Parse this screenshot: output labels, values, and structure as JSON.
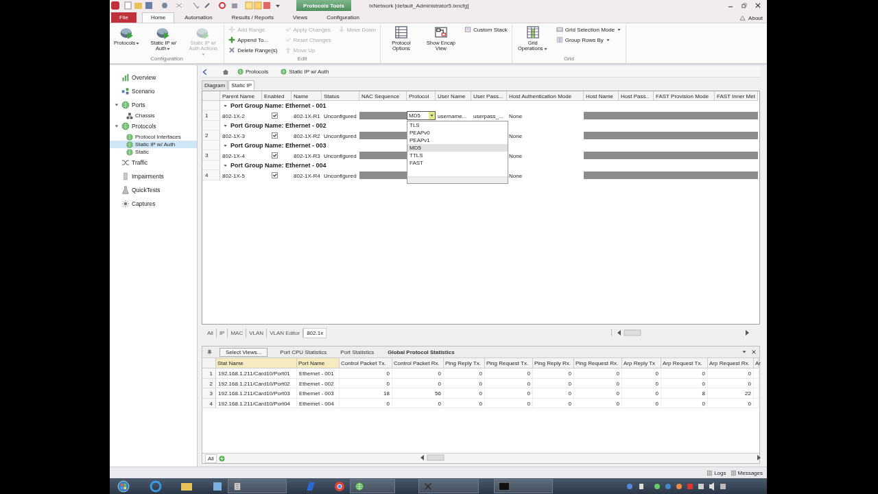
{
  "title_bar": {
    "context_tab": "Protocols Tools",
    "title": "IxNetwork [default_Administrator5.ixncfg]"
  },
  "ribbon_tabs": [
    {
      "label": "File",
      "kind": "file",
      "selected": false
    },
    {
      "label": "Home",
      "kind": "tab",
      "selected": true
    },
    {
      "label": "Automation",
      "kind": "tab",
      "selected": false
    },
    {
      "label": "Results / Reports",
      "kind": "tab",
      "selected": false
    },
    {
      "label": "Views",
      "kind": "tab",
      "selected": false
    },
    {
      "label": "Configuration",
      "kind": "tab",
      "selected": false
    }
  ],
  "about": "About",
  "ribbon_groups": [
    {
      "label": "Configuration",
      "items": [
        {
          "kind": "large",
          "label": "Protocols",
          "disabled": false,
          "dropdown": true
        },
        {
          "kind": "large",
          "label": "Static IP w/ Auth",
          "disabled": false,
          "dropdown": true
        },
        {
          "kind": "large",
          "label": "Static IP w/ Auth Actions",
          "disabled": true,
          "dropdown": true
        }
      ]
    },
    {
      "label": "Edit",
      "items": [
        {
          "kind": "small",
          "label": "Add Range",
          "disabled": true,
          "dropdown": false
        },
        {
          "kind": "small",
          "label": "Append To...",
          "disabled": false,
          "dropdown": false
        },
        {
          "kind": "small",
          "label": "Delete Range(s)",
          "disabled": false,
          "dropdown": false
        },
        {
          "kind": "small",
          "label": "Apply Changes",
          "disabled": true,
          "dropdown": false
        },
        {
          "kind": "small",
          "label": "Reset Changes",
          "disabled": true,
          "dropdown": false
        },
        {
          "kind": "small",
          "label": "Move Up",
          "disabled": true,
          "dropdown": false
        },
        {
          "kind": "small",
          "label": "Move Down",
          "disabled": true,
          "dropdown": false
        }
      ]
    },
    {
      "items": [
        {
          "kind": "large",
          "label": "Protocol Options",
          "disabled": false,
          "dropdown": false
        },
        {
          "kind": "large",
          "label": "Show Encap View",
          "disabled": false,
          "dropdown": false
        },
        {
          "kind": "small",
          "label": "Custom Stack",
          "disabled": false,
          "dropdown": false
        }
      ]
    },
    {
      "label": "Grid",
      "items": [
        {
          "kind": "large",
          "label": "Grid Operations",
          "disabled": false,
          "dropdown": true
        },
        {
          "kind": "small",
          "label": "Grid Selection Mode",
          "disabled": false,
          "dropdown": true
        },
        {
          "kind": "small",
          "label": "Group Rows By",
          "disabled": false,
          "dropdown": true
        }
      ]
    }
  ],
  "sidebar": {
    "items": [
      {
        "label": "Overview",
        "selected": false
      },
      {
        "label": "Scenario",
        "selected": false
      },
      {
        "label": "Ports",
        "selected": false,
        "expanded": true,
        "children": [
          {
            "label": "Chassis",
            "selected": false
          }
        ]
      },
      {
        "label": "Protocols",
        "selected": false,
        "expanded": true,
        "children": [
          {
            "label": "Protocol Interfaces",
            "selected": false
          },
          {
            "label": "Static IP w/ Auth",
            "selected": true
          },
          {
            "label": "Static",
            "selected": false
          }
        ]
      },
      {
        "label": "Traffic",
        "selected": false
      },
      {
        "label": "Impairments",
        "selected": false
      },
      {
        "label": "QuickTests",
        "selected": false
      },
      {
        "label": "Captures",
        "selected": false
      }
    ]
  },
  "breadcrumb": [
    "Protocols",
    "Static IP w/ Auth"
  ],
  "view_tabs": [
    {
      "label": "Diagram",
      "selected": false
    },
    {
      "label": "Static IP",
      "selected": true
    }
  ],
  "grid": {
    "columns": [
      "Parent Name",
      "Enabled",
      "Name",
      "Status",
      "NAC Sequence",
      "Protocol",
      "User Name",
      "User Pass...",
      "Host Authentication Mode",
      "Host Name",
      "Host Pass..",
      "FAST Provision Mode",
      "FAST Inner Met"
    ],
    "groups": [
      {
        "header": "Port Group Name: Ethernet - 001",
        "row": {
          "index": "1",
          "parent_name": "802-1X-2",
          "enabled": true,
          "name": "802-1X-R1",
          "status": "Unconfigured",
          "greyed": true,
          "protocol": "MD5",
          "user_name": "username...",
          "user_pass": "userpass_...",
          "host_auth": "None"
        }
      },
      {
        "header": "Port Group Name: Ethernet - 002",
        "row": {
          "index": "2",
          "parent_name": "802-1X-3",
          "enabled": true,
          "name": "802-1X-R2",
          "status": "Unconfigured",
          "greyed": true,
          "host_auth": "None"
        }
      },
      {
        "header": "Port Group Name: Ethernet - 003",
        "row": {
          "index": "3",
          "parent_name": "802-1X-4",
          "enabled": true,
          "name": "802-1X-R3",
          "status": "Unconfigured",
          "greyed": true,
          "host_auth": "None"
        }
      },
      {
        "header": "Port Group Name: Ethernet - 004",
        "row": {
          "index": "4",
          "parent_name": "802-1X-5",
          "enabled": true,
          "name": "802-1X-R4",
          "status": "Unconfigured",
          "greyed": true,
          "host_auth": "None"
        }
      }
    ],
    "dropdown": {
      "options": [
        {
          "label": "TLS",
          "selected": false
        },
        {
          "label": "PEAPv0",
          "selected": false
        },
        {
          "label": "PEAPv1",
          "selected": false
        },
        {
          "label": "MD5",
          "selected": true
        },
        {
          "label": "TTLS",
          "selected": false
        },
        {
          "label": "FAST",
          "selected": false
        }
      ]
    }
  },
  "filter_tabs": [
    {
      "label": "All",
      "selected": false
    },
    {
      "label": "IP",
      "selected": false
    },
    {
      "label": "MAC",
      "selected": false
    },
    {
      "label": "VLAN",
      "selected": false
    },
    {
      "label": "VLAN Editor",
      "selected": false
    },
    {
      "label": "802.1x",
      "selected": true
    }
  ],
  "stats": {
    "select_views": "Select Views...",
    "tabs": [
      {
        "label": "Port CPU Statistics",
        "selected": false
      },
      {
        "label": "Port Statistics",
        "selected": false
      },
      {
        "label": "Global Protocol Statistics",
        "selected": true
      }
    ],
    "columns": [
      "Stat Name",
      "Port Name",
      "Control Packet Tx.",
      "Control Packet Rx.",
      "Ping Reply Tx.",
      "Ping Request Tx.",
      "Ping Reply Rx.",
      "Ping Request Rx.",
      "Arp Reply Tx",
      "Arp Request Tx.",
      "Arp Request Rx.",
      "Ar"
    ],
    "rows": [
      {
        "index": "1",
        "cells": [
          "192.168.1.211/Card10/Port01",
          "Ethernet - 001",
          "0",
          "0",
          "0",
          "0",
          "0",
          "0",
          "0",
          "0",
          "0"
        ]
      },
      {
        "index": "2",
        "cells": [
          "192.168.1.211/Card10/Port02",
          "Ethernet - 002",
          "0",
          "0",
          "0",
          "0",
          "0",
          "0",
          "0",
          "0",
          "0"
        ]
      },
      {
        "index": "3",
        "cells": [
          "192.168.1.211/Card10/Port03",
          "Ethernet - 003",
          "18",
          "56",
          "0",
          "0",
          "0",
          "0",
          "0",
          "8",
          "22"
        ]
      },
      {
        "index": "4",
        "cells": [
          "192.168.1.211/Card10/Port04",
          "Ethernet - 004",
          "0",
          "0",
          "0",
          "0",
          "0",
          "0",
          "0",
          "0",
          "0"
        ]
      }
    ],
    "footer_tab": "All"
  },
  "status_bar": [
    "Logs",
    "Messages"
  ]
}
